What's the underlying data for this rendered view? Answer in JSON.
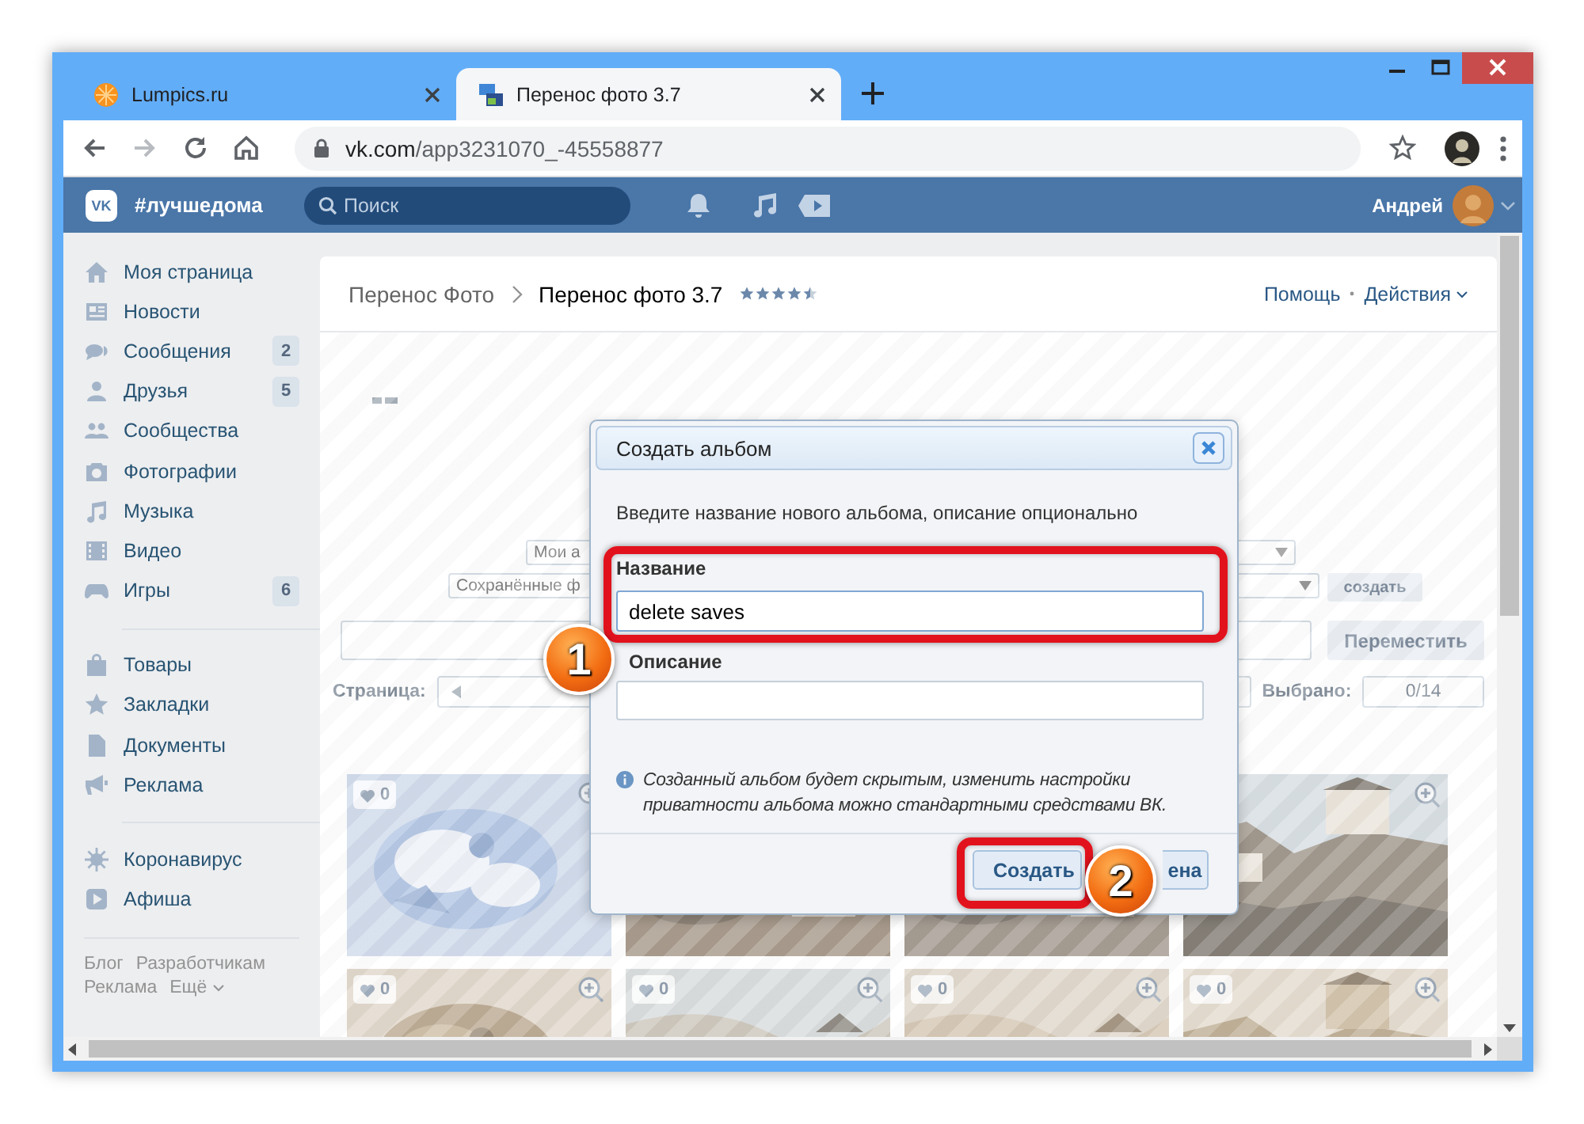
{
  "browser": {
    "tabs": [
      {
        "title": "Lumpics.ru",
        "selected": false
      },
      {
        "title": "Перенос фото 3.7",
        "selected": true
      }
    ],
    "nav_buttons": [
      {
        "kind": "back",
        "disabled": false
      },
      {
        "kind": "forward",
        "disabled": true
      },
      {
        "kind": "reload",
        "disabled": false
      },
      {
        "kind": "home",
        "disabled": false
      }
    ],
    "url_host": "vk.com",
    "url_path": "/app3231070_-45558877"
  },
  "vk_header": {
    "logo": "VK",
    "community": "#лучшедома",
    "search_placeholder": "Поиск",
    "user_name": "Андрей"
  },
  "sidebar": {
    "groups": [
      [
        {
          "label": "Моя страница"
        },
        {
          "label": "Новости"
        },
        {
          "label": "Сообщения",
          "badge": "2"
        },
        {
          "label": "Друзья",
          "badge": "5"
        },
        {
          "label": "Сообщества"
        },
        {
          "label": "Фотографии"
        },
        {
          "label": "Музыка"
        },
        {
          "label": "Видео"
        },
        {
          "label": "Игры",
          "badge": "6"
        }
      ],
      [
        {
          "label": "Товары"
        },
        {
          "label": "Закладки"
        },
        {
          "label": "Документы"
        },
        {
          "label": "Реклама"
        }
      ],
      [
        {
          "label": "Коронавирус"
        },
        {
          "label": "Афиша"
        }
      ]
    ],
    "footer_links": [
      "Блог",
      "Разработчикам",
      "Реклама",
      "Ещё"
    ]
  },
  "app": {
    "breadcrumb": "Перенос Фото",
    "title": "Перенос фото 3.7",
    "stars": 4.5,
    "header_links": [
      "Помощь",
      "Действия"
    ],
    "album_select": "Мои а",
    "source_select": "Сохранённые ф",
    "create_small_button": "создать",
    "move_button": "Переместить",
    "page_label": "Страница:",
    "selected_label": "Выбрано:",
    "selected_count": "0/14",
    "photos": [
      {
        "likes": "0",
        "zoom": true
      },
      {
        "zoom": false
      },
      {
        "zoom": false
      },
      {
        "zoom": true
      },
      {
        "likes": "0",
        "zoom": true
      },
      {
        "likes": "0",
        "zoom": true
      },
      {
        "likes": "0",
        "zoom": true
      },
      {
        "likes": "0",
        "zoom": true
      }
    ]
  },
  "dialog": {
    "title": "Создать альбом",
    "intro": "Введите название нового альбома, описание опционально",
    "fields": [
      {
        "label": "Название",
        "value": "delete saves",
        "focused": true
      },
      {
        "label": "Описание",
        "focused": false
      }
    ],
    "note": "Созданный альбом будет скрытым, изменить настройки приватности альбома можно стандартными средствами ВК.",
    "buttons": [
      {
        "label": "Создать",
        "kind": "primary"
      },
      {
        "label": "ена",
        "kind": "secondary"
      }
    ]
  },
  "annotations": [
    {
      "number": "1"
    },
    {
      "number": "2"
    }
  ]
}
